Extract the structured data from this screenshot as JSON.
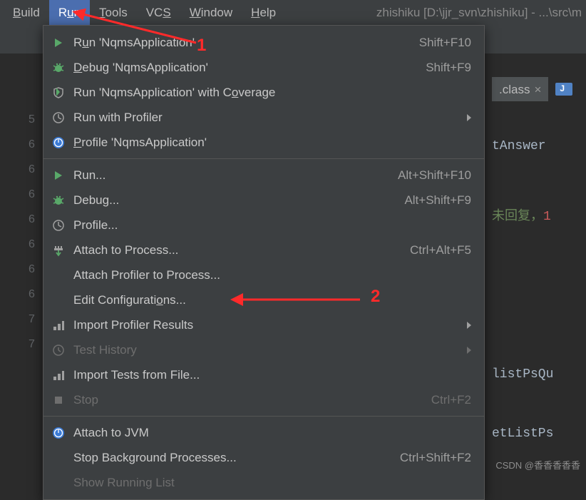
{
  "menubar": {
    "items": [
      {
        "label": "Build",
        "u": 0
      },
      {
        "label": "Run",
        "u": 1,
        "active": true
      },
      {
        "label": "Tools",
        "u": 0
      },
      {
        "label": "VCS",
        "u": 2
      },
      {
        "label": "Window",
        "u": 0
      },
      {
        "label": "Help",
        "u": 0
      }
    ],
    "title": "zhishiku [D:\\jjr_svn\\zhishiku] - ...\\src\\m"
  },
  "dropdown": [
    {
      "icon": "play",
      "label": "Run 'NqmsApplication'",
      "u": 1,
      "shortcut": "Shift+F10"
    },
    {
      "icon": "bug",
      "label": "Debug 'NqmsApplication'",
      "u": 0,
      "shortcut": "Shift+F9"
    },
    {
      "icon": "coverage",
      "label": "Run 'NqmsApplication' with Coverage",
      "u": 28
    },
    {
      "icon": "profiler",
      "label": "Run with Profiler",
      "submenu": true
    },
    {
      "icon": "profile",
      "label": "Profile 'NqmsApplication'",
      "u": 0
    },
    {
      "sep": true
    },
    {
      "icon": "play",
      "label": "Run...",
      "shortcut": "Alt+Shift+F10"
    },
    {
      "icon": "bug",
      "label": "Debug...",
      "shortcut": "Alt+Shift+F9"
    },
    {
      "icon": "profiler",
      "label": "Profile..."
    },
    {
      "icon": "attach",
      "label": "Attach to Process...",
      "shortcut": "Ctrl+Alt+F5"
    },
    {
      "icon": "",
      "label": "Attach Profiler to Process..."
    },
    {
      "icon": "",
      "label": "Edit Configurations...",
      "u": 16
    },
    {
      "icon": "import",
      "label": "Import Profiler Results",
      "submenu": true
    },
    {
      "icon": "clock",
      "label": "Test History",
      "submenu": true,
      "disabled": true
    },
    {
      "icon": "import",
      "label": "Import Tests from File..."
    },
    {
      "icon": "stop",
      "label": "Stop",
      "shortcut": "Ctrl+F2",
      "disabled": true
    },
    {
      "sep": true
    },
    {
      "icon": "profile",
      "label": "Attach to JVM"
    },
    {
      "icon": "",
      "label": "Stop Background Processes...",
      "shortcut": "Ctrl+Shift+F2"
    },
    {
      "icon": "",
      "label": "Show Running List",
      "disabled": true
    }
  ],
  "gutter": [
    "5",
    "6",
    "6",
    "6",
    "6",
    "6",
    "6",
    "6",
    "7",
    "7"
  ],
  "tab": {
    "label": ".class",
    "close": "×"
  },
  "code_snippets": {
    "l1": "tAnswer",
    "l2a": "未回复，",
    "l2b": "1",
    "l3": "listPsQu",
    "l4": "etListPs"
  },
  "annotations": {
    "one": "1",
    "two": "2"
  },
  "watermark": "CSDN @香香香香香"
}
